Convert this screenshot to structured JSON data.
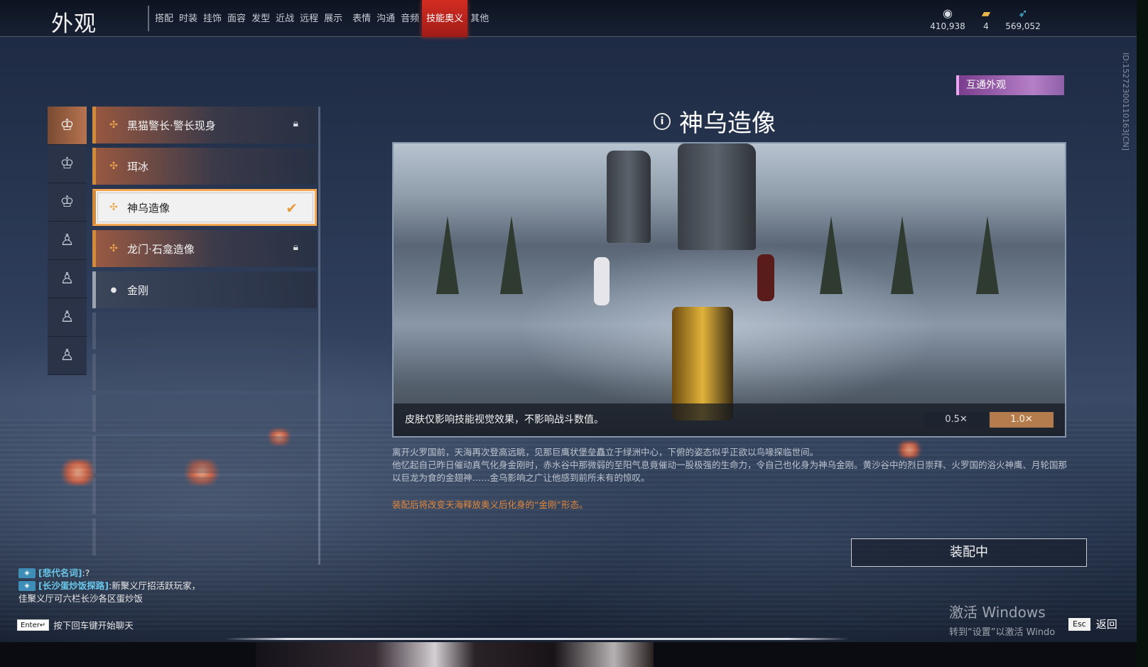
{
  "header": {
    "title": "外观",
    "tabs": [
      "搭配",
      "时装",
      "挂饰",
      "面容",
      "发型",
      "近战",
      "远程",
      "展示",
      "表情",
      "沟通",
      "音频",
      "技能奥义",
      "其他"
    ],
    "active_tab": "技能奥义",
    "currencies": [
      {
        "icon": "coin-icon",
        "value": "410,938"
      },
      {
        "icon": "ticket-icon",
        "value": "4"
      },
      {
        "icon": "feather-icon",
        "value": "569,052"
      }
    ]
  },
  "categories": [
    "cat-1",
    "cat-2",
    "cat-3",
    "cat-4",
    "cat-5",
    "cat-6",
    "cat-7"
  ],
  "skins": [
    {
      "name": "黑猫警长·警长现身",
      "locked": true
    },
    {
      "name": "珥冰",
      "locked": false
    },
    {
      "name": "神乌造像",
      "selected": true
    },
    {
      "name": "龙门·石龛造像",
      "locked": true
    },
    {
      "name": "金刚",
      "plain": true
    }
  ],
  "detail": {
    "cross_badge": "互通外观",
    "title": "神乌造像",
    "caption": "皮肤仅影响技能视觉效果，不影响战斗数值。",
    "speed_slow": "0.5✕",
    "speed_normal": "1.0✕",
    "desc_1": "离开火罗国前，天海再次登高远眺，见那巨鹰状堡垒矗立于绿洲中心，下俯的姿态似乎正欲以鸟喙探临世间。",
    "desc_2": "他忆起自己昨日催动真气化身金刚时，赤水谷中那微弱的至阳气息竟催动一股极强的生命力，令自己也化身为神乌金刚。黄沙谷中的烈日崇拜、火罗国的浴火神鹰、月轮国那以巨龙为食的金翅神……金乌影响之广让他感到前所未有的惊叹。",
    "note": "装配后将改变天海释放奥义后化身的“金刚”形态。",
    "equip_button": "装配中"
  },
  "chat": {
    "line1_nick": "[悲代名词]",
    "line1_msg": ":?",
    "line2_nick": "[长沙蛋炒饭探路]",
    "line2_msg": ":新聚义厅招活跃玩家，",
    "line3": "佳聚义厅可六栏长沙各区蛋炒饭",
    "enter_key": "Enter↵",
    "enter_hint": "按下回车键开始聊天"
  },
  "footer": {
    "watermark_big": "激活 Windows",
    "watermark_small": "转到“设置”以激活 Windo",
    "esc_key": "Esc",
    "back_label": "返回"
  },
  "side_id": "ID:15272300110163[CN]"
}
